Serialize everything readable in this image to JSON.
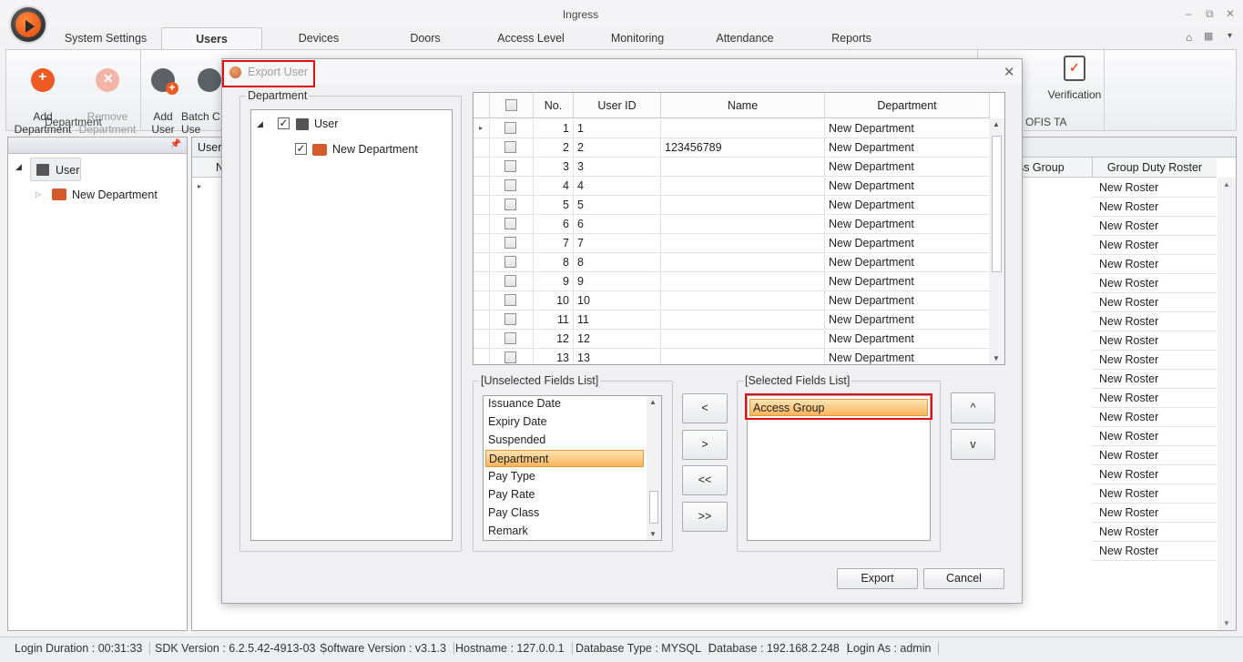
{
  "app": {
    "title": "Ingress",
    "window_controls": [
      "–",
      "⧉",
      "✕"
    ],
    "top_right_controls": [
      "⌂",
      "▾"
    ]
  },
  "tabs": [
    "System Settings",
    "Users",
    "Devices",
    "Doors",
    "Access Level",
    "Monitoring",
    "Attendance",
    "Reports"
  ],
  "active_tab": "Users",
  "ribbon": {
    "add_department": "Add\nDepartment",
    "remove_department": "Remove\nDepartment",
    "department_group": "Department",
    "add_user": "Add\nUser",
    "batch_user": "Batch C\nUse",
    "partial_label_1": "ion",
    "verification": "Verification",
    "fis_ta_group": "OFIS TA"
  },
  "left_tree": {
    "root": "User",
    "child": "New Department"
  },
  "right_grid": {
    "tab_label": "Users",
    "col_partial": "N",
    "col_access_group": "ess Group",
    "col_duty_roster": "Group Duty Roster",
    "rosters": [
      "New Roster",
      "New Roster",
      "New Roster",
      "New Roster",
      "New Roster",
      "New Roster",
      "New Roster",
      "New Roster",
      "New Roster",
      "New Roster",
      "New Roster",
      "New Roster",
      "New Roster",
      "New Roster",
      "New Roster",
      "New Roster",
      "New Roster",
      "New Roster",
      "New Roster",
      "New Roster"
    ]
  },
  "dialog": {
    "title": "Export User",
    "department_legend": "Department",
    "tree_root": "User",
    "tree_child": "New Department",
    "grid_headers": {
      "no": "No.",
      "user_id": "User ID",
      "name": "Name",
      "department": "Department"
    },
    "rows": [
      {
        "no": "1",
        "id": "1",
        "name": "",
        "dept": "New Department"
      },
      {
        "no": "2",
        "id": "2",
        "name": "123456789",
        "dept": "New Department"
      },
      {
        "no": "3",
        "id": "3",
        "name": "",
        "dept": "New Department"
      },
      {
        "no": "4",
        "id": "4",
        "name": "",
        "dept": "New Department"
      },
      {
        "no": "5",
        "id": "5",
        "name": "",
        "dept": "New Department"
      },
      {
        "no": "6",
        "id": "6",
        "name": "",
        "dept": "New Department"
      },
      {
        "no": "7",
        "id": "7",
        "name": "",
        "dept": "New Department"
      },
      {
        "no": "8",
        "id": "8",
        "name": "",
        "dept": "New Department"
      },
      {
        "no": "9",
        "id": "9",
        "name": "",
        "dept": "New Department"
      },
      {
        "no": "10",
        "id": "10",
        "name": "",
        "dept": "New Department"
      },
      {
        "no": "11",
        "id": "11",
        "name": "",
        "dept": "New Department"
      },
      {
        "no": "12",
        "id": "12",
        "name": "",
        "dept": "New Department"
      },
      {
        "no": "13",
        "id": "13",
        "name": "",
        "dept": "New Department"
      }
    ],
    "unselected_legend": "[Unselected Fields List]",
    "unselected_fields": [
      "Issuance Date",
      "Expiry Date",
      "Suspended",
      "Department",
      "Pay Type",
      "Pay Rate",
      "Pay Class",
      "Remark"
    ],
    "unselected_selected": "Department",
    "selected_legend": "[Selected Fields List]",
    "selected_fields": [
      "Access Group"
    ],
    "move_buttons": [
      "<",
      ">",
      "<<",
      ">>"
    ],
    "order_buttons": [
      "^",
      "v"
    ],
    "export_label": "Export",
    "cancel_label": "Cancel"
  },
  "status": {
    "login_duration": "Login Duration : 00:31:33",
    "sdk_version": "SDK Version : 6.2.5.42-4913-03",
    "software_version": "Software Version : v3.1.3",
    "hostname": "Hostname : 127.0.0.1",
    "database_type": "Database Type : MYSQL",
    "database": "Database : 192.168.2.248",
    "login_as": "Login As : admin"
  },
  "colors": {
    "highlight_red": "#e01010",
    "selection_orange": "#f6b45c",
    "brand_orange": "#ee5a24"
  }
}
